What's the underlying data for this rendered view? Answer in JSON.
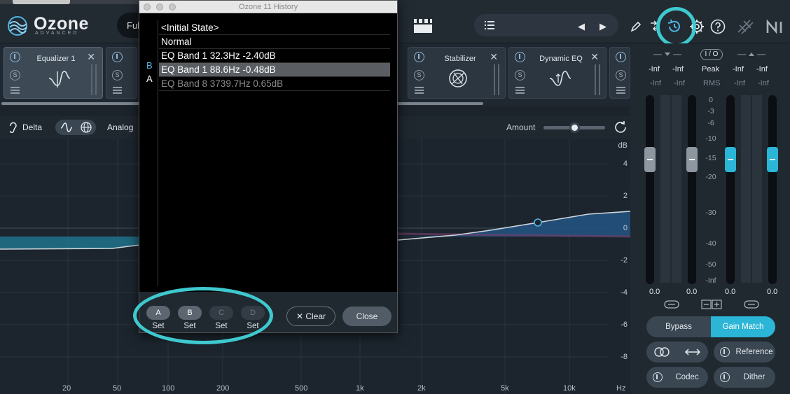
{
  "host": {
    "tab_label": "Ozone 11"
  },
  "app": {
    "name": "Ozone",
    "edition": "ADVANCED",
    "preset_label": "Ful"
  },
  "header_icons": [
    "clapper-icon",
    "list-icon",
    "pencil-icon",
    "route-icon",
    "history-icon",
    "gear-icon",
    "help-icon",
    "connect-icon",
    "ni-logo"
  ],
  "modules": [
    {
      "title": "Equalizer 1",
      "active": true
    },
    {
      "title": "",
      "active": false
    },
    {
      "title": "Stabilizer",
      "active": false
    },
    {
      "title": "Dynamic EQ",
      "active": false
    },
    {
      "title": "",
      "active": false
    }
  ],
  "eq_toolbar": {
    "delta": "Delta",
    "analog": "Analog",
    "amount": "Amount",
    "amount_value": 0.5
  },
  "eq_display": {
    "db_unit": "dB",
    "db_labels": [
      "4",
      "2",
      "0",
      "-2",
      "-4",
      "-6",
      "-8"
    ],
    "hz_labels": [
      "20",
      "50",
      "100",
      "200",
      "500",
      "1k",
      "2k",
      "5k",
      "10k",
      "Hz"
    ]
  },
  "history": {
    "window_title": "Ozone 11 History",
    "ab_markers": {
      "b": "B",
      "a": "A"
    },
    "items": [
      {
        "label": "<Initial State>",
        "state": "normal"
      },
      {
        "label": "Normal",
        "state": "normal"
      },
      {
        "label": "EQ Band 1 32.3Hz -2.40dB",
        "state": "normal"
      },
      {
        "label": "EQ Band 1 88.6Hz -0.48dB",
        "state": "selected"
      },
      {
        "label": "EQ Band 8 3739.7Hz 0.65dB",
        "state": "undone"
      }
    ],
    "slots": [
      {
        "letter": "A",
        "set": "Set",
        "enabled": true
      },
      {
        "letter": "B",
        "set": "Set",
        "enabled": true
      },
      {
        "letter": "C",
        "set": "Set",
        "enabled": false
      },
      {
        "letter": "D",
        "set": "Set",
        "enabled": false
      }
    ],
    "clear_label": "Clear",
    "close_label": "Close"
  },
  "meters": {
    "in_top": [
      "-Inf",
      "-Inf"
    ],
    "in_bottom": [
      "-Inf",
      "-Inf"
    ],
    "out_top": [
      "-Inf",
      "-Inf"
    ],
    "out_bottom": [
      "-Inf",
      "-Inf"
    ],
    "io_label": "I / O",
    "peak_label": "Peak",
    "rms_label": "RMS",
    "scale": [
      "0",
      "-3",
      "-6",
      "-10",
      "-15",
      "-20",
      "-30",
      "-40",
      "-50",
      "-Inf"
    ],
    "values": [
      "0.0",
      "0.0",
      "0.0",
      "0.0"
    ],
    "bypass_label": "Bypass",
    "gain_match_label": "Gain Match",
    "reference_label": "Reference",
    "codec_label": "Codec",
    "dither_label": "Dither"
  },
  "colors": {
    "accent": "#3ec9cf",
    "fader_active": "#2bb5d6",
    "eq_fill": "#23527e"
  }
}
